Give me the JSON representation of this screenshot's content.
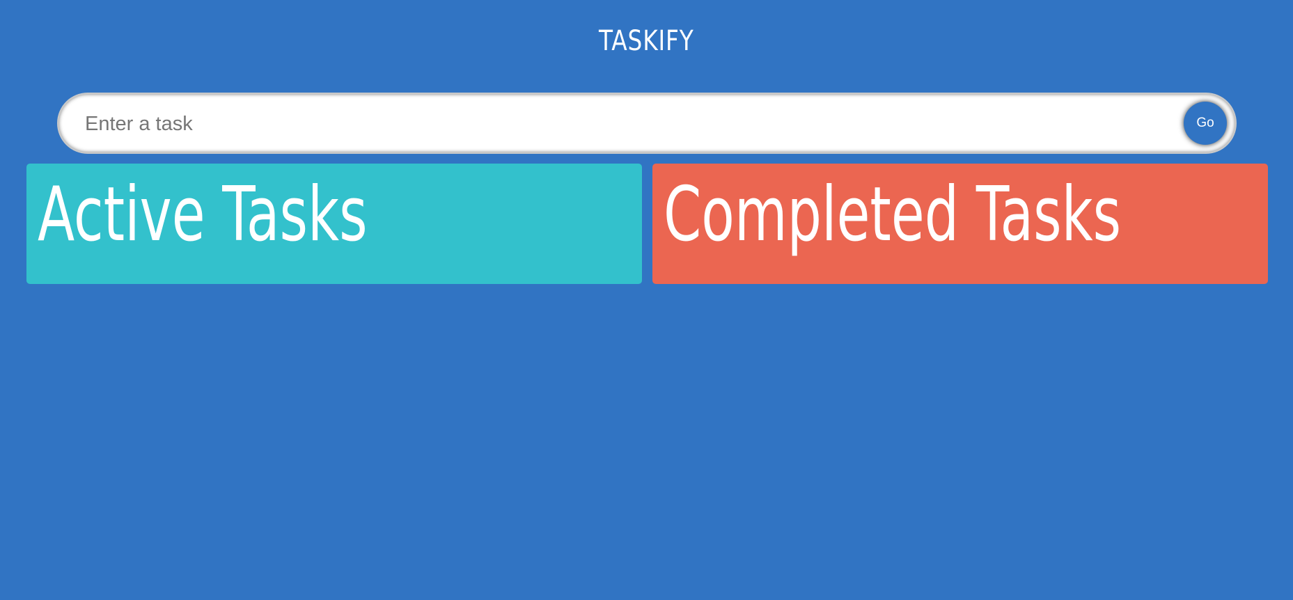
{
  "app": {
    "title": "TASKIFY"
  },
  "task_form": {
    "input_placeholder": "Enter a task",
    "input_value": "",
    "submit_label": "Go"
  },
  "panels": {
    "active": {
      "heading": "Active Tasks",
      "color": "#33c1cc",
      "items": []
    },
    "completed": {
      "heading": "Completed Tasks",
      "color": "#eb6651",
      "items": []
    }
  },
  "theme": {
    "background": "#3174c3",
    "button": "#3174c3"
  }
}
